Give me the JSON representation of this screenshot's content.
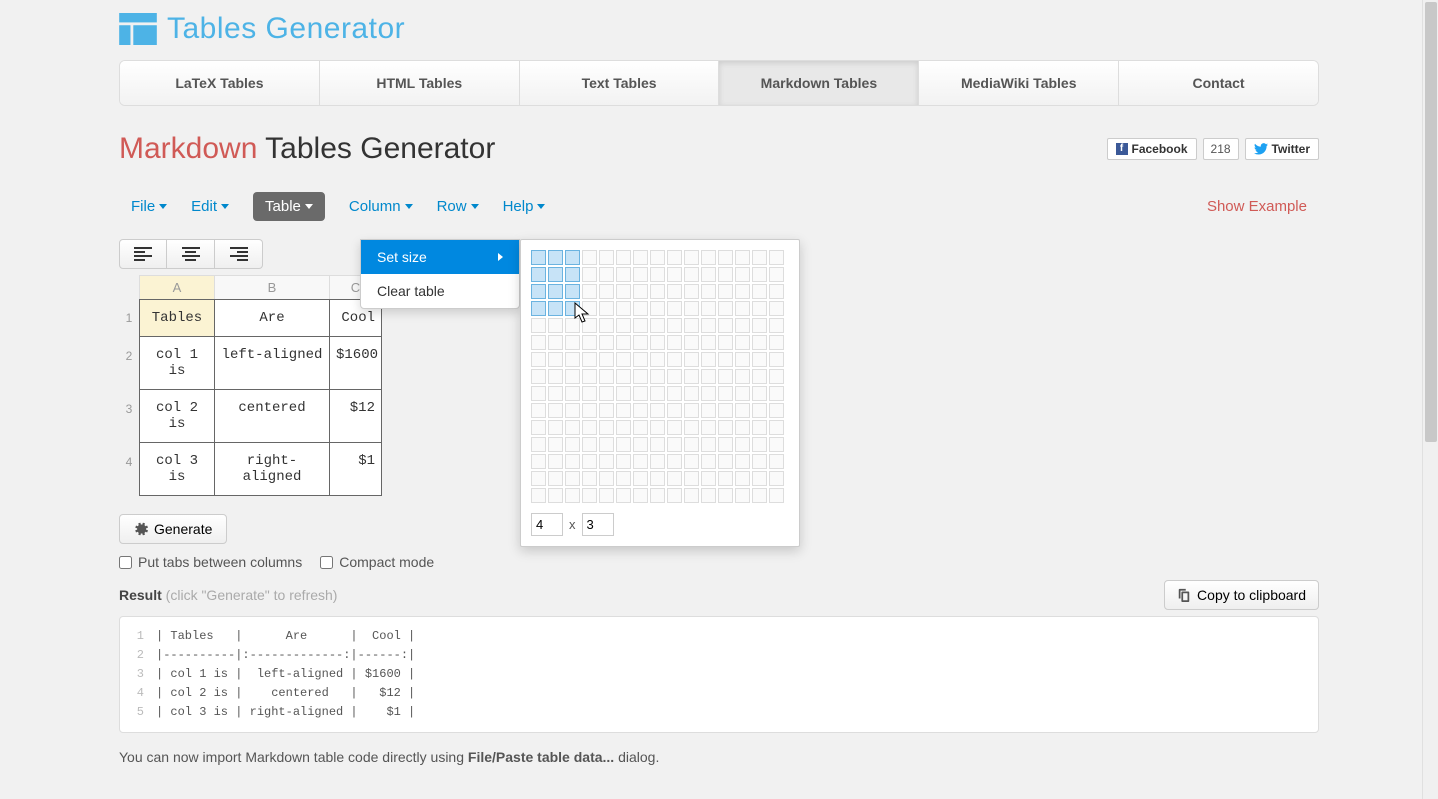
{
  "logo_text": "Tables Generator",
  "nav_tabs": [
    "LaTeX Tables",
    "HTML Tables",
    "Text Tables",
    "Markdown Tables",
    "MediaWiki Tables",
    "Contact"
  ],
  "active_tab_index": 3,
  "page_title_accent": "Markdown",
  "page_title_rest": " Tables Generator",
  "social": {
    "fb_label": "Facebook",
    "fb_count": "218",
    "tw_label": "Twitter"
  },
  "menubar": [
    "File",
    "Edit",
    "Table",
    "Column",
    "Row",
    "Help"
  ],
  "active_menu_index": 2,
  "show_example": "Show Example",
  "dropdown": {
    "set_size": "Set size",
    "clear_table": "Clear table"
  },
  "size_picker": {
    "rows": "4",
    "cols": "3",
    "sep": "x",
    "grid_rows": 15,
    "grid_cols": 15,
    "hover_row": 4,
    "hover_col": 3
  },
  "table": {
    "col_labels": [
      "A",
      "B",
      "C"
    ],
    "rows": [
      {
        "n": "1",
        "cells": [
          "Tables",
          "Are",
          "Cool"
        ]
      },
      {
        "n": "2",
        "cells": [
          "col 1 is",
          "left-aligned",
          "$1600"
        ]
      },
      {
        "n": "3",
        "cells": [
          "col 2 is",
          "centered",
          "$12"
        ]
      },
      {
        "n": "4",
        "cells": [
          "col 3 is",
          "right-aligned",
          "$1"
        ]
      }
    ]
  },
  "generate_label": "Generate",
  "checks": {
    "tabs": "Put tabs between columns",
    "compact": "Compact mode"
  },
  "result_label": "Result",
  "result_hint": " (click \"Generate\" to refresh)",
  "copy_label": "Copy to clipboard",
  "output": [
    "| Tables   |      Are      |  Cool |",
    "|----------|:-------------:|------:|",
    "| col 1 is |  left-aligned | $1600 |",
    "| col 2 is |    centered   |   $12 |",
    "| col 3 is | right-aligned |    $1 |"
  ],
  "footer_note_pre": "You can now import Markdown table code directly using ",
  "footer_note_bold": "File/Paste table data...",
  "footer_note_post": " dialog."
}
